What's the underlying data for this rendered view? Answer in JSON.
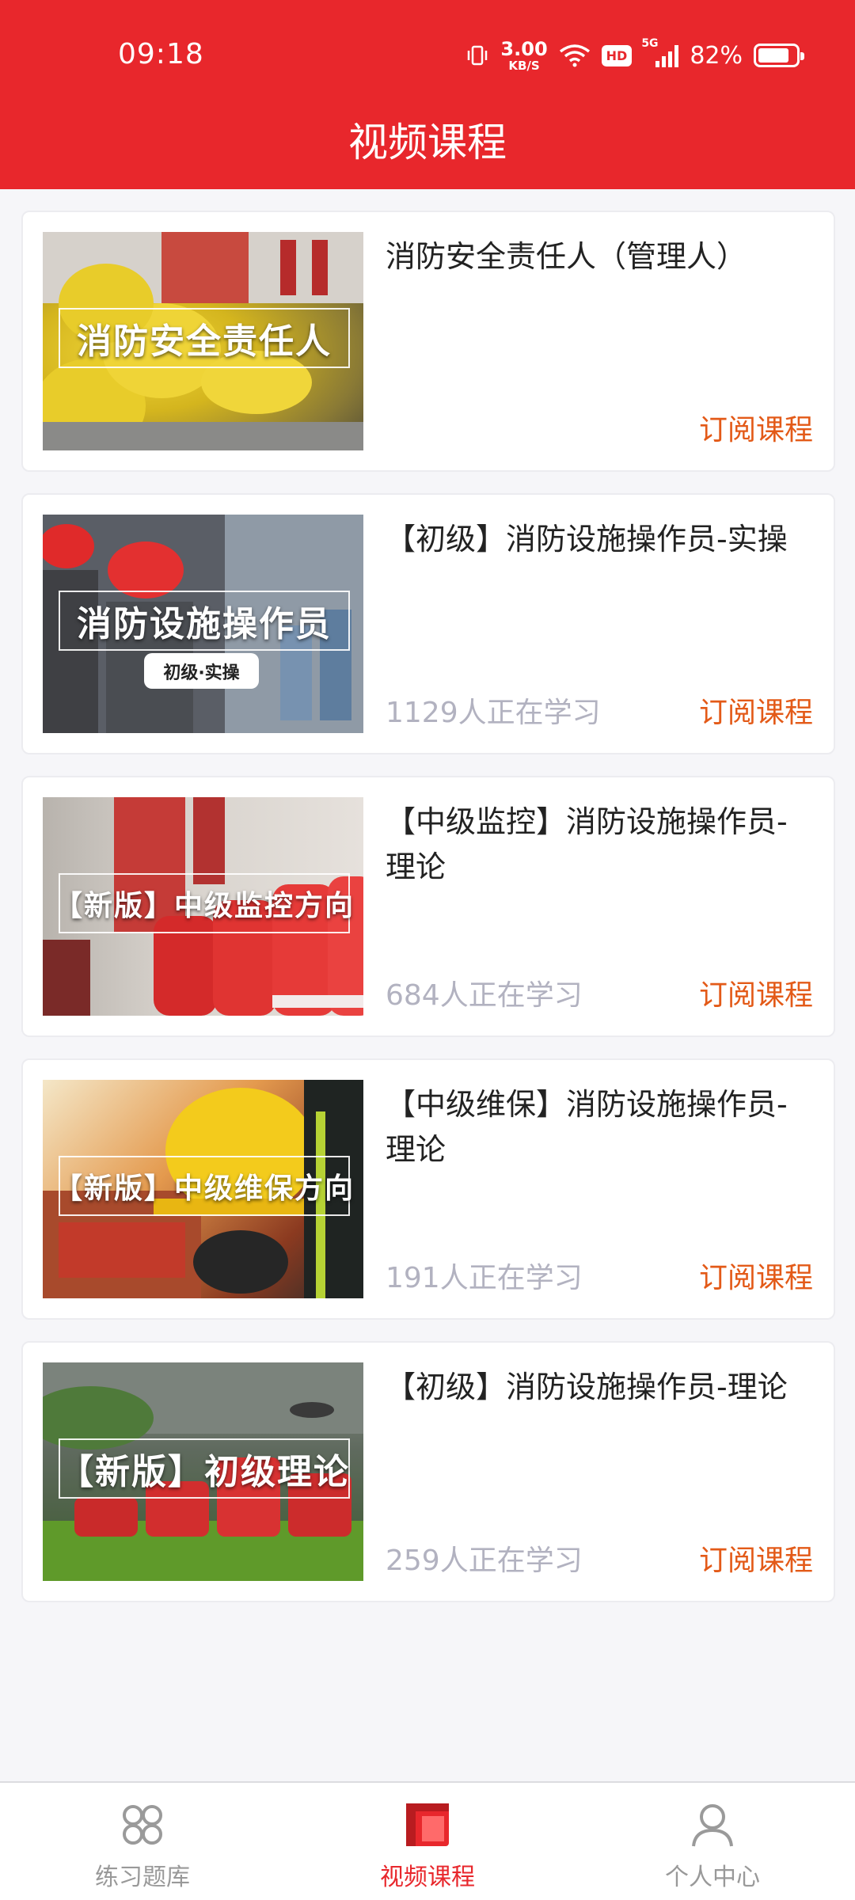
{
  "status_bar": {
    "time": "09:18",
    "network_speed_value": "3.00",
    "network_speed_unit": "KB/S",
    "hd_label": "HD",
    "signal_label": "5G",
    "battery": "82%",
    "battery_level": 0.82
  },
  "header": {
    "title": "视频课程"
  },
  "courses": [
    {
      "thumb_banner": "消防安全责任人",
      "thumb_tag": "",
      "title": "消防安全责任人（管理人）",
      "learners": "",
      "subscribe_label": "订阅课程"
    },
    {
      "thumb_banner": "消防设施操作员",
      "thumb_tag": "初级·实操",
      "title": "【初级】消防设施操作员-实操",
      "learners": "1129人正在学习",
      "subscribe_label": "订阅课程"
    },
    {
      "thumb_banner": "【新版】中级监控方向",
      "thumb_tag": "",
      "title": "【中级监控】消防设施操作员-理论",
      "learners": "684人正在学习",
      "subscribe_label": "订阅课程"
    },
    {
      "thumb_banner": "【新版】中级维保方向",
      "thumb_tag": "",
      "title": "【中级维保】消防设施操作员-理论",
      "learners": "191人正在学习",
      "subscribe_label": "订阅课程"
    },
    {
      "thumb_banner": "【新版】初级理论",
      "thumb_tag": "",
      "title": "【初级】消防设施操作员-理论",
      "learners": "259人正在学习",
      "subscribe_label": "订阅课程"
    }
  ],
  "bottom_nav": {
    "items": [
      {
        "label": "练习题库",
        "icon": "grid-icon",
        "active": false
      },
      {
        "label": "视频课程",
        "icon": "video-course-icon",
        "active": true
      },
      {
        "label": "个人中心",
        "icon": "person-icon",
        "active": false
      }
    ]
  },
  "colors": {
    "brand": "#e8272c",
    "subscribe": "#e35a18",
    "muted": "#b2b2c0"
  }
}
